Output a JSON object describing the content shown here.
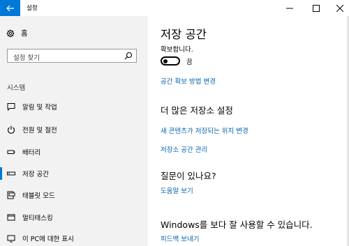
{
  "window": {
    "title": "설정",
    "controls": [
      "minimize",
      "maximize",
      "close"
    ]
  },
  "sidebar": {
    "home_label": "홈",
    "search_placeholder": "설정 찾기",
    "section_label": "시스템",
    "items": [
      {
        "label": "알림 및 작업",
        "icon": "message-icon"
      },
      {
        "label": "전원 및 절전",
        "icon": "power-icon"
      },
      {
        "label": "배터리",
        "icon": "battery-icon"
      },
      {
        "label": "저장 공간",
        "icon": "storage-icon",
        "active": true
      },
      {
        "label": "태블릿 모드",
        "icon": "tablet-mode-icon"
      },
      {
        "label": "멀티태스킹",
        "icon": "multitasking-icon"
      },
      {
        "label": "이 PC에 대한 표시",
        "icon": "project-icon"
      }
    ]
  },
  "main": {
    "title": "저장 공간",
    "partial_text": "확보합니다.",
    "toggle_label": "끔",
    "toggle_state": "off",
    "link_free_space": "공간 확보 방법 변경",
    "more_settings_heading": "더 많은 저장소 설정",
    "link_save_location": "새 콘텐츠가 저장되는 위치 변경",
    "link_manage_spaces": "저장소 공간 관리",
    "question_heading": "질문이 있나요?",
    "link_help": "도움말 보기",
    "better_heading": "Windows를 보다 잘 사용할 수 있습니다.",
    "link_feedback": "피드백 보내기"
  },
  "colors": {
    "accent": "#0078d7",
    "link": "#0063b1",
    "sidebar_bg": "#f2f2f2"
  }
}
